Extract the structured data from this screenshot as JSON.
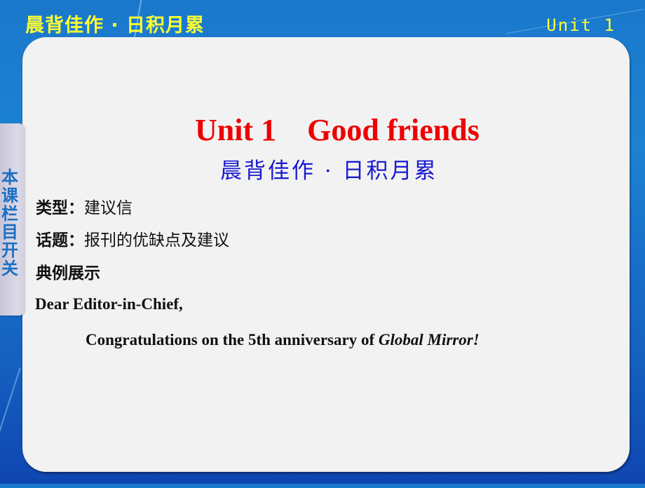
{
  "header": {
    "section_title": "晨背佳作 · 日积月累",
    "unit_label": "Unit 1"
  },
  "side_tab": {
    "label": "本课栏目开关"
  },
  "content": {
    "title": "Unit 1    Good friends",
    "subtitle": "晨背佳作 · 日积月累",
    "type_label": "类型：",
    "type_value": "建议信",
    "topic_label": "话题：",
    "topic_value": "报刊的优缺点及建议",
    "example_heading": "典例展示",
    "greeting": "Dear Editor-in-Chief,",
    "body_text": "Congratulations on the 5th anniversary of ",
    "body_italic": "Global Mirror!"
  },
  "colors": {
    "header_text": "#ffff33",
    "title_red": "#ee0000",
    "subtitle_blue": "#1a1ad0",
    "side_tab_text": "#1b6fc4",
    "panel_bg": "#f2f2f2"
  }
}
